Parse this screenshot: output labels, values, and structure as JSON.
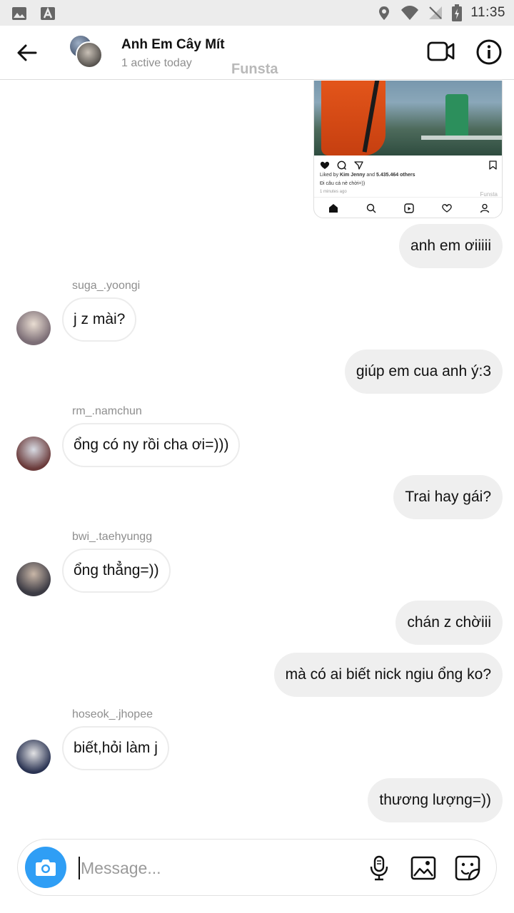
{
  "status_bar": {
    "time": "11:35",
    "left_icons": [
      "image-icon",
      "font-icon"
    ],
    "right_icons": [
      "location-icon",
      "wifi-icon",
      "no-signal-icon",
      "battery-charging-icon"
    ]
  },
  "header": {
    "title": "Anh Em Cây Mít",
    "subtitle": "1 active today",
    "watermark": "Funsta",
    "back_icon": "arrow-left-icon",
    "video_icon": "video-camera-icon",
    "info_icon": "info-circle-icon"
  },
  "shared_post": {
    "likes_prefix": "Liked by ",
    "likes_user": "Kim Jenny",
    "likes_and": " and ",
    "likes_count": "5.435.464 others",
    "caption": "Đi câu cá nè chời=))",
    "time_ago": "1 minutes ago",
    "brand": "Funsta"
  },
  "messages": [
    {
      "type": "out",
      "text": "anh em ơiiiii"
    },
    {
      "type": "in",
      "sender": "suga_.yoongi",
      "text": "j z mài?"
    },
    {
      "type": "out",
      "text": "giúp em cua anh ý:3"
    },
    {
      "type": "in",
      "sender": "rm_.namchun",
      "text": "ổng có ny rồi cha ơi=)))"
    },
    {
      "type": "out",
      "text": "Trai hay gái?"
    },
    {
      "type": "in",
      "sender": "bwi_.taehyungg",
      "text": "ổng thẳng=))"
    },
    {
      "type": "out",
      "text": "chán z chờiii"
    },
    {
      "type": "out",
      "text": "mà có ai biết nick ngiu ổng ko?"
    },
    {
      "type": "in",
      "sender": "hoseok_.jhopee",
      "text": "biết,hỏi làm j"
    },
    {
      "type": "out",
      "text": "thương lượng=))"
    }
  ],
  "composer": {
    "placeholder": "Message...",
    "value": "",
    "camera_icon": "camera-icon",
    "mic_icon": "microphone-icon",
    "gallery_icon": "gallery-icon",
    "sticker_icon": "sticker-icon"
  },
  "colors": {
    "accent": "#2f9ef5",
    "bubble_out": "#efefef",
    "muted_text": "#8e8e8e"
  }
}
